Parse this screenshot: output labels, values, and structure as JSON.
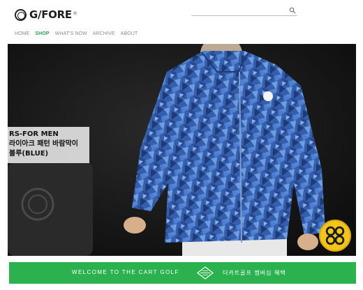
{
  "header": {
    "logo_text": "G/FORE",
    "favorite_icon": "star-icon",
    "search": {
      "placeholder": "",
      "value": "",
      "icon": "search-icon"
    }
  },
  "nav": {
    "items": [
      {
        "label": "HOME",
        "active": false
      },
      {
        "label": "SHOP",
        "active": true
      },
      {
        "label": "WHAT'S NOW",
        "active": false
      },
      {
        "label": "ARCHIVE",
        "active": false
      },
      {
        "label": "ABOUT",
        "active": false
      }
    ]
  },
  "hero": {
    "caption": {
      "line1": "RS-FOR MEN",
      "line2": "라이아크 패턴 바람막이",
      "line3": "블루(BLUE)"
    },
    "badge_icon": "gfore-logo-icon"
  },
  "banner": {
    "left_text": "WELCOME TO THE CART GOLF",
    "logo_icon": "diamond-logo-icon",
    "right_text": "더카트골프 멤버십 혜택"
  },
  "colors": {
    "accent_green": "#2bb24f",
    "nav_active": "#2aa05a",
    "jacket_blue": "#3a68b8",
    "badge_yellow": "#f3c51b"
  }
}
